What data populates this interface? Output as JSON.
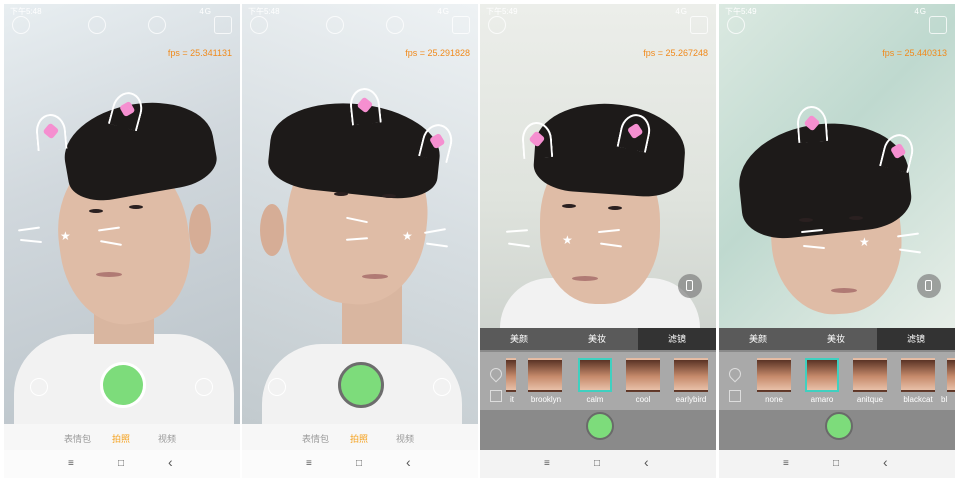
{
  "status": {
    "time_1": "下午5:48",
    "time_2": "下午5:48",
    "time_3": "下午5:49",
    "time_4": "下午5:49",
    "network": "4G"
  },
  "fps": {
    "panel1": "fps = 25.341131",
    "panel2": "fps = 25.291828",
    "panel3": "fps = 25.267248",
    "panel4": "fps = 25.440313"
  },
  "modes": {
    "sticker": "表情包",
    "photo": "拍照",
    "video": "视频"
  },
  "sheet_tabs": {
    "beauty": "美颜",
    "makeup": "美妆",
    "filter": "滤镜"
  },
  "filters_panel3": [
    "it",
    "brooklyn",
    "calm",
    "cool",
    "earlybird"
  ],
  "filters_panel4": [
    "none",
    "amaro",
    "anitque",
    "blackcat",
    "bl"
  ],
  "nav": {
    "menu": "≡",
    "home": "□",
    "back": "‹"
  },
  "colors": {
    "fps": "#f08a1c",
    "active_mode": "#f5a11d",
    "shutter": "#7ddc7b",
    "selected_filter": "#3fd0c0"
  }
}
